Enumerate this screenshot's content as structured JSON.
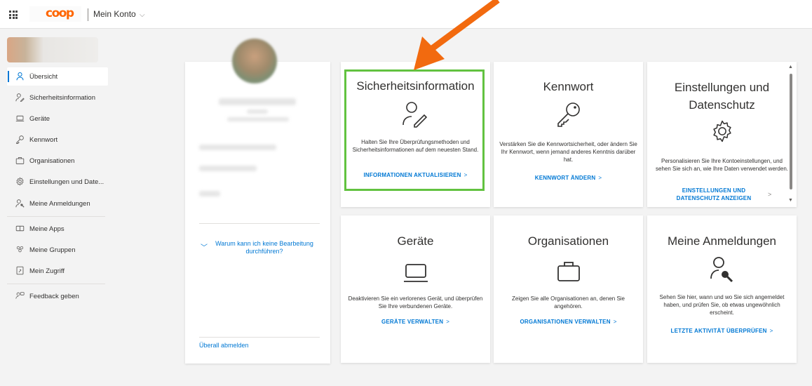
{
  "header": {
    "logo": "coop",
    "account_label": "Mein Konto",
    "account_chevron": "⌵"
  },
  "sidebar": {
    "items": [
      {
        "label": "Übersicht",
        "icon": "person-icon",
        "active": true
      },
      {
        "label": "Sicherheitsinformation",
        "icon": "person-edit-icon"
      },
      {
        "label": "Geräte",
        "icon": "laptop-icon"
      },
      {
        "label": "Kennwort",
        "icon": "key-icon"
      },
      {
        "label": "Organisationen",
        "icon": "briefcase-icon"
      },
      {
        "label": "Einstellungen und Date...",
        "icon": "gear-icon"
      },
      {
        "label": "Meine Anmeldungen",
        "icon": "person-key-icon"
      },
      {
        "label": "Meine Apps",
        "icon": "apps-icon"
      },
      {
        "label": "Meine Gruppen",
        "icon": "groups-icon"
      },
      {
        "label": "Mein Zugriff",
        "icon": "access-icon"
      },
      {
        "label": "Feedback geben",
        "icon": "feedback-icon"
      }
    ]
  },
  "profile": {
    "why_link": "Warum kann ich keine Bearbeitung durchführen?",
    "logout_link": "Überall abmelden"
  },
  "tiles": {
    "security": {
      "title": "Sicherheitsinformation",
      "description": "Halten Sie Ihre Überprüfungsmethoden und Sicherheitsinformationen auf dem neuesten Stand.",
      "link": "INFORMATIONEN AKTUALISIEREN"
    },
    "password": {
      "title": "Kennwort",
      "description": "Verstärken Sie die Kennwortsicherheit, oder ändern Sie Ihr Kennwort, wenn jemand anderes Kenntnis darüber hat.",
      "link": "KENNWORT ÄNDERN"
    },
    "settings": {
      "title": "Einstellungen und Datenschutz",
      "description": "Personalisieren Sie Ihre Kontoeinstellungen, und sehen Sie sich an, wie Ihre Daten verwendet werden.",
      "link": "EINSTELLUNGEN UND DATENSCHUTZ ANZEIGEN"
    },
    "devices": {
      "title": "Geräte",
      "description": "Deaktivieren Sie ein verlorenes Gerät, und überprüfen Sie Ihre verbundenen Geräte.",
      "link": "GERÄTE VERWALTEN"
    },
    "organizations": {
      "title": "Organisationen",
      "description": "Zeigen Sie alle Organisationen an, denen Sie angehören.",
      "link": "ORGANISATIONEN VERWALTEN"
    },
    "signins": {
      "title": "Meine Anmeldungen",
      "description": "Sehen Sie hier, wann und wo Sie sich angemeldet haben, und prüfen Sie, ob etwas ungewöhnlich erscheint.",
      "link": "LETZTE AKTIVITÄT ÜBERPRÜFEN"
    }
  },
  "link_arrow": ">",
  "colors": {
    "accent": "#0078d4",
    "highlight": "#62c240",
    "annotation_arrow": "#f26a0f",
    "brand": "#ff6600"
  }
}
